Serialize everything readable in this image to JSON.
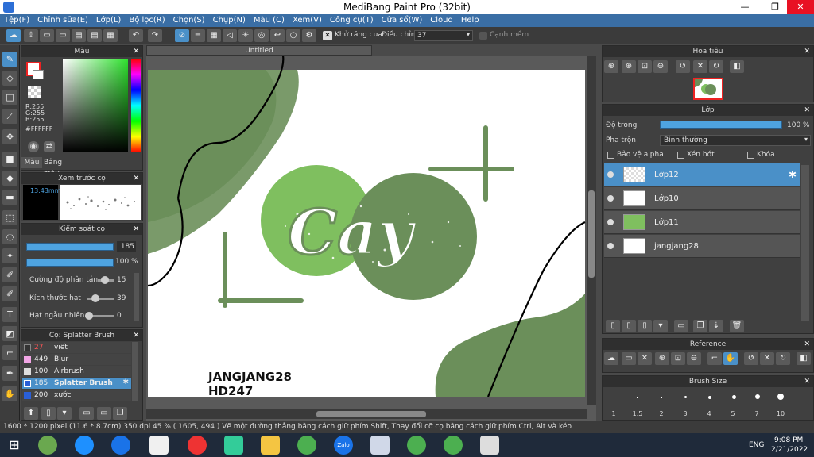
{
  "window": {
    "title": "MediBang Paint Pro (32bit)",
    "min": "—",
    "restore": "❐",
    "close": "✕"
  },
  "menu": [
    "Tệp(F)",
    "Chỉnh sửa(E)",
    "Lớp(L)",
    "Bộ lọc(R)",
    "Chọn(S)",
    "Chụp(N)",
    "Màu (C)",
    "Xem(V)",
    "Công cụ(T)",
    "Cửa sổ(W)",
    "Cloud",
    "Help"
  ],
  "toolbar": {
    "antialias": "Khử răng cưa",
    "adjust": "Điều chỉnh",
    "adjust_value": "37",
    "edge": "Cạnh mềm"
  },
  "color_panel": {
    "title": "Màu",
    "r": "R:255",
    "g": "G:255",
    "b": "B:255",
    "hex": "#FFFFFF",
    "tab1": "Màu",
    "tab2": "Bảng màu"
  },
  "preview_panel": {
    "title": "Xem trước cọ",
    "size": "13.43mm"
  },
  "brush_ctrl": {
    "title": "Kiểm soát cọ",
    "size": "185",
    "opacity": "100 %",
    "s1": "Cường độ phân tán",
    "v1": "15",
    "s2": "Kích thước hạt",
    "v2": "39",
    "s3": "Hạt ngẫu nhiên",
    "v3": "0"
  },
  "brush_list": {
    "title": "Cọ: Splatter Brush",
    "items": [
      {
        "size": "27",
        "name": "viết",
        "color": "#333333",
        "sel": false
      },
      {
        "size": "449",
        "name": "Blur",
        "color": "#f2a6e6",
        "sel": false
      },
      {
        "size": "100",
        "name": "Airbrush",
        "color": "#dddddd",
        "sel": false
      },
      {
        "size": "185",
        "name": "Splatter Brush",
        "color": "#2a5fd6",
        "sel": true
      },
      {
        "size": "200",
        "name": "xước",
        "color": "#2a5fd6",
        "sel": false
      }
    ]
  },
  "doc": {
    "tab": "Untitled",
    "author": "JANGJANG28",
    "code": "HD247",
    "logo_text": "Cay"
  },
  "navigator": {
    "title": "Hoa tiêu"
  },
  "layer_panel": {
    "title": "Lớp",
    "opacity_label": "Độ trong",
    "opacity_value": "100 %",
    "blend_label": "Pha trộn",
    "blend_value": "Bình thường",
    "protect_alpha": "Bảo vệ alpha",
    "clipping": "Xén bớt",
    "lock": "Khóa",
    "layers": [
      "Lớp12",
      "Lớp10",
      "Lớp11",
      "jangjang28"
    ],
    "selected": "Lớp12"
  },
  "reference": {
    "title": "Reference"
  },
  "brush_size": {
    "title": "Brush Size",
    "sizes": [
      "1",
      "1.5",
      "2",
      "3",
      "4",
      "5",
      "7",
      "10"
    ]
  },
  "status": {
    "text": "1600 * 1200 pixel   (11.6 * 8.7cm)  350 dpi  45 %  ( 1605, 494 )  Vẽ một đường thẳng bằng cách giữ phím Shift, Thay đổi cỡ cọ bằng cách giữ phím Ctrl, Alt và kéo"
  },
  "taskbar": {
    "lang": "ENG",
    "time": "9:08 PM",
    "date": "2/21/2022",
    "zalo": "Zalo"
  },
  "colors": {
    "accent": "#3a6ea5",
    "green_light": "#7fbf5f",
    "green_dark": "#6b8f5a",
    "green_fill": "#76a860",
    "select": "#4a90c8"
  }
}
